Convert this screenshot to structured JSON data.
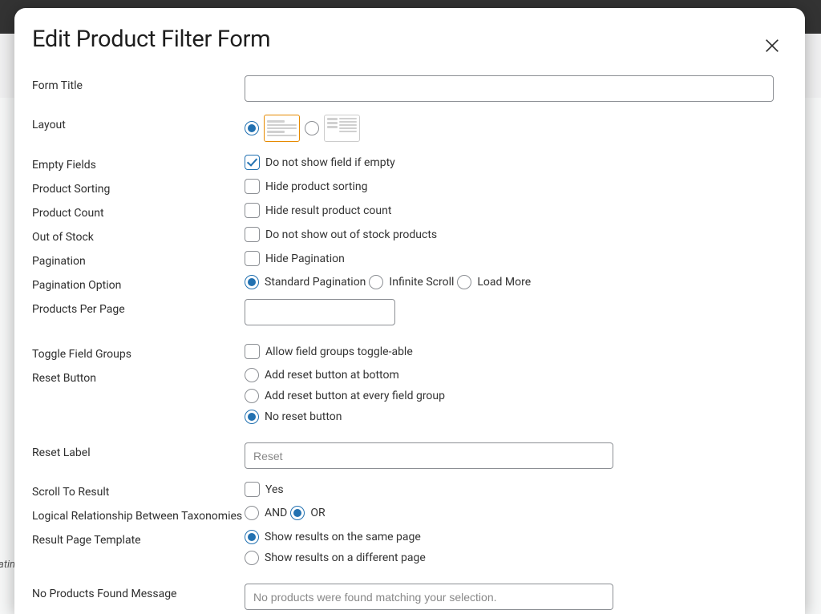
{
  "bg_italic_fragment": "atin",
  "modal": {
    "title": "Edit Product Filter Form",
    "fields": {
      "form_title": {
        "label": "Form Title",
        "value": ""
      },
      "layout": {
        "label": "Layout",
        "selected": "vertical"
      },
      "empty_fields": {
        "label": "Empty Fields",
        "checkbox_label": "Do not show field if empty",
        "checked": true
      },
      "product_sorting": {
        "label": "Product Sorting",
        "checkbox_label": "Hide product sorting",
        "checked": false
      },
      "product_count": {
        "label": "Product Count",
        "checkbox_label": "Hide result product count",
        "checked": false
      },
      "out_of_stock": {
        "label": "Out of Stock",
        "checkbox_label": "Do not show out of stock products",
        "checked": false
      },
      "pagination": {
        "label": "Pagination",
        "checkbox_label": "Hide Pagination",
        "checked": false
      },
      "pagination_option": {
        "label": "Pagination Option",
        "options": [
          "Standard Pagination",
          "Infinite Scroll",
          "Load More"
        ],
        "selected": "Standard Pagination"
      },
      "products_per_page": {
        "label": "Products Per Page",
        "value": ""
      },
      "toggle_field_groups": {
        "label": "Toggle Field Groups",
        "checkbox_label": "Allow field groups toggle-able",
        "checked": false
      },
      "reset_button": {
        "label": "Reset Button",
        "options": [
          "Add reset button at bottom",
          "Add reset button at every field group",
          "No reset button"
        ],
        "selected": "No reset button"
      },
      "reset_label": {
        "label": "Reset Label",
        "placeholder": "Reset",
        "value": ""
      },
      "scroll_to_result": {
        "label": "Scroll To Result",
        "checkbox_label": "Yes",
        "checked": false
      },
      "logical_rel": {
        "label": "Logical Relationship Between Taxonomies",
        "options": [
          "AND",
          "OR"
        ],
        "selected": "OR"
      },
      "result_page_template": {
        "label": "Result Page Template",
        "options": [
          "Show results on the same page",
          "Show results on a different page"
        ],
        "selected": "Show results on the same page"
      },
      "no_products_message": {
        "label": "No Products Found Message",
        "placeholder": "No products were found matching your selection.",
        "value": ""
      }
    }
  }
}
